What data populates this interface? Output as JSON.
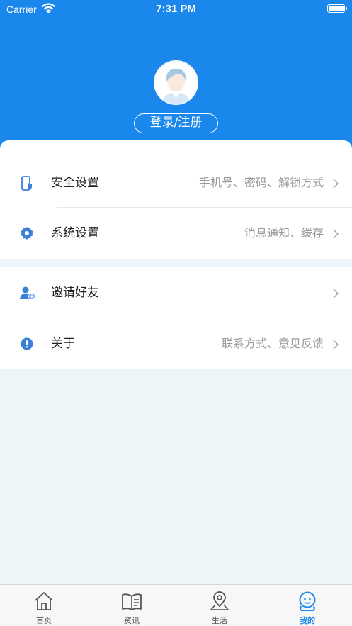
{
  "status_bar": {
    "carrier": "Carrier",
    "time": "7:31 PM"
  },
  "profile": {
    "login_label": "登录/注册"
  },
  "menu_group_1": [
    {
      "label": "安全设置",
      "detail": "手机号、密码、解锁方式",
      "icon": "phone-shield-icon"
    },
    {
      "label": "系统设置",
      "detail": "消息通知、缓存",
      "icon": "gear-icon"
    }
  ],
  "menu_group_2": [
    {
      "label": "邀请好友",
      "detail": "",
      "icon": "add-user-icon"
    },
    {
      "label": "关于",
      "detail": "联系方式、意见反馈",
      "icon": "info-icon"
    }
  ],
  "tabs": [
    {
      "label": "首页",
      "icon": "home-icon",
      "active": false
    },
    {
      "label": "资讯",
      "icon": "book-icon",
      "active": false
    },
    {
      "label": "生活",
      "icon": "location-pin-icon",
      "active": false
    },
    {
      "label": "我的",
      "icon": "profile-face-icon",
      "active": true
    }
  ],
  "colors": {
    "primary": "#1a87ec",
    "background": "#eef5f8",
    "muted_text": "#9a9a9a"
  }
}
